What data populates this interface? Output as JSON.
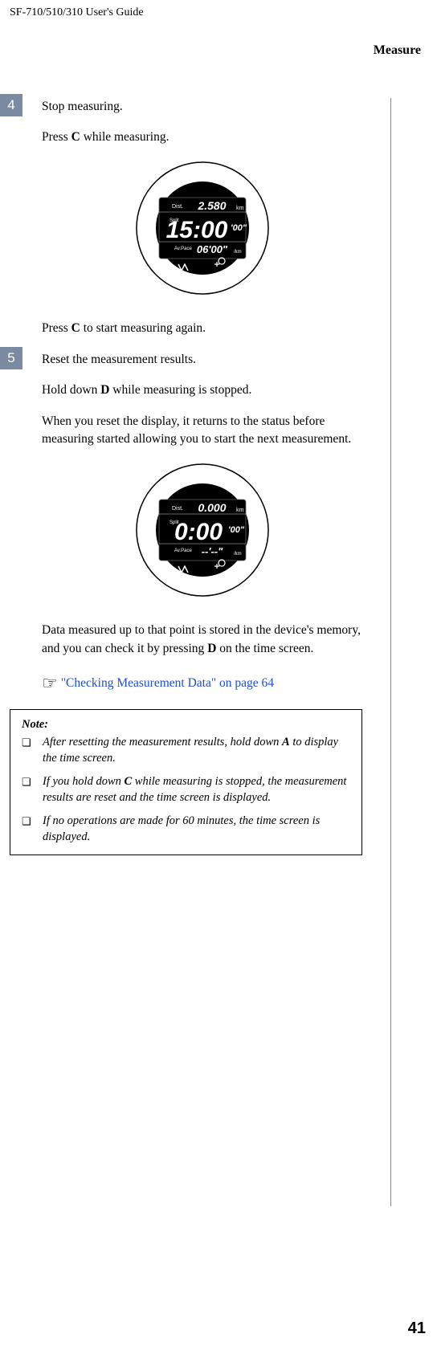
{
  "header": "SF-710/510/310     User's Guide",
  "section_title": "Measure",
  "steps": [
    {
      "num": "4",
      "lead": "Stop measuring.",
      "lines": [
        {
          "pre": "Press ",
          "bold": "C",
          "post": " while measuring."
        }
      ],
      "after_lines": [
        {
          "pre": "Press ",
          "bold": "C",
          "post": " to start measuring again."
        }
      ],
      "watch": {
        "dist_label": "Dist.",
        "dist_val": "2.580",
        "dist_unit": "km",
        "split_label": "Split",
        "main_time": "15:00",
        "main_sec": "'00\"",
        "pace_label": "Av.Pace",
        "pace_val": "06'00\"",
        "pace_unit": "/km"
      }
    },
    {
      "num": "5",
      "lead": "Reset the measurement results.",
      "lines": [
        {
          "pre": "Hold down ",
          "bold": "D",
          "post": " while measuring is stopped."
        },
        {
          "plain": "When you reset the display, it returns to the status before measuring started allowing you to start the next measurement."
        }
      ],
      "after_lines": [
        {
          "pre": "Data measured up to that point is stored in the device's memory, and you can check it by pressing ",
          "bold": "D",
          "post": " on the time screen."
        }
      ],
      "watch": {
        "dist_label": "Dist.",
        "dist_val": "0.000",
        "dist_unit": "km",
        "split_label": "Split",
        "main_time": "0:00",
        "main_sec": "'00\"",
        "pace_label": "Av.Pace",
        "pace_val": "--'--\"",
        "pace_unit": "/km"
      }
    }
  ],
  "cross_ref": "\"Checking Measurement Data\" on page 64",
  "note": {
    "title": "Note:",
    "items": [
      {
        "pre": "After resetting the measurement results, hold down ",
        "bold": "A",
        "post": " to display the time screen."
      },
      {
        "pre": "If you hold down ",
        "bold": "C",
        "post": " while measuring is stopped, the measurement results are reset and the time screen is displayed."
      },
      {
        "plain": "If no operations are made for 60 minutes, the time screen is displayed."
      }
    ]
  },
  "page": "41"
}
